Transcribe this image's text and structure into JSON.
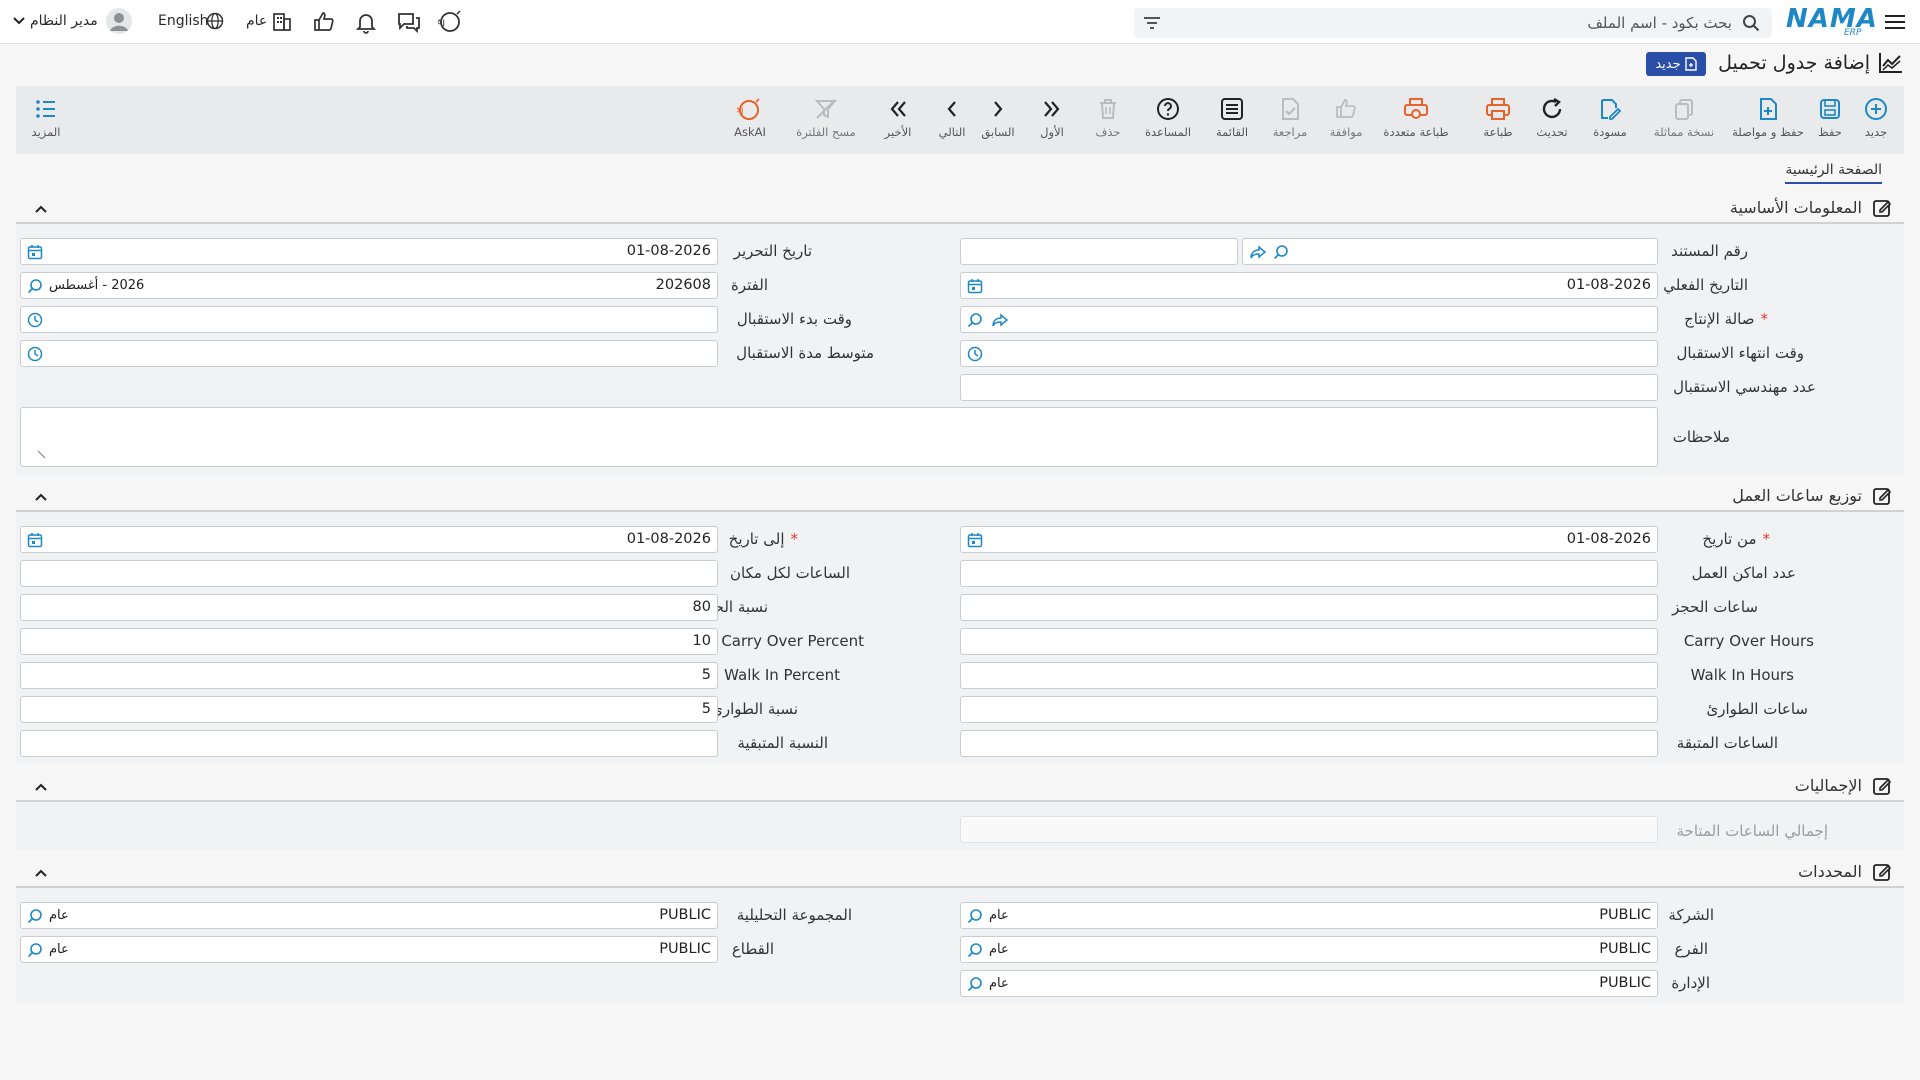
{
  "header": {
    "logo_text": "NAMA",
    "logo_sub": "ERP",
    "search_placeholder": "بحث بكود - اسم الملف",
    "user_name": "مدير النظام",
    "language": "English",
    "scope": "عام"
  },
  "page": {
    "title": "إضافة جدول تحميل",
    "badge": "جديد"
  },
  "toolbar": {
    "items": [
      {
        "label": "جديد",
        "icon": "plus-circle-icon",
        "enabled": true
      },
      {
        "label": "حفظ",
        "icon": "save-icon",
        "enabled": true
      },
      {
        "label": "حفظ و مواصلة",
        "icon": "save-continue-icon",
        "enabled": true
      },
      {
        "label": "نسخة مماثلة",
        "icon": "copy-icon",
        "enabled": false
      },
      {
        "label": "مسودة",
        "icon": "draft-icon",
        "enabled": true
      },
      {
        "label": "تحديث",
        "icon": "refresh-icon",
        "enabled": true
      },
      {
        "label": "طباعة",
        "icon": "print-icon",
        "enabled": true
      },
      {
        "label": "طباعة متعددة",
        "icon": "multi-print-icon",
        "enabled": true
      },
      {
        "label": "موافقة",
        "icon": "thumb-up-icon",
        "enabled": false
      },
      {
        "label": "مراجعة",
        "icon": "review-icon",
        "enabled": false
      },
      {
        "label": "القائمة",
        "icon": "list-icon",
        "enabled": true
      },
      {
        "label": "المساعدة",
        "icon": "help-icon",
        "enabled": true
      },
      {
        "label": "حذف",
        "icon": "trash-icon",
        "enabled": false
      },
      {
        "label": "الأول",
        "icon": "first-icon",
        "enabled": true
      },
      {
        "label": "السابق",
        "icon": "previous-icon",
        "enabled": true
      },
      {
        "label": "التالي",
        "icon": "next-icon",
        "enabled": true
      },
      {
        "label": "الأخير",
        "icon": "last-icon",
        "enabled": true
      },
      {
        "label": "مسح الفلترة",
        "icon": "clear-filter-icon",
        "enabled": false
      },
      {
        "label": "AskAI",
        "icon": "ask-ai-icon",
        "enabled": true
      }
    ],
    "more_label": "المزيد"
  },
  "tabs": {
    "main": "الصفحة الرئيسية"
  },
  "sections": {
    "basic": "المعلومات الأساسية",
    "hours": "توزيع ساعات العمل",
    "totals": "الإجماليات",
    "dims": "المحددات"
  },
  "basic": {
    "doc_no_label": "رقم المستند",
    "doc_no_value": "",
    "edit_date_label": "تاريخ التحرير",
    "edit_date_value": "01-08-2026",
    "actual_date_label": "التاريخ الفعلي",
    "actual_date_value": "01-08-2026",
    "period_label": "الفترة",
    "period_value": "202608",
    "period_tag": "2026 - أغسطس",
    "hall_label": "صالة الإنتاج",
    "hall_value": "",
    "recv_start_label": "وقت بدء الاستقبال",
    "recv_start_value": "",
    "recv_end_label": "وقت انتهاء الاستقبال",
    "recv_end_value": "",
    "avg_duration_label": "متوسط مدة الاستقبال",
    "avg_duration_value": "",
    "engineers_label": "عدد مهندسي الاستقبال",
    "engineers_value": "",
    "notes_label": "ملاحظات",
    "notes_value": ""
  },
  "hours": {
    "from_date_label": "من تاريخ",
    "from_date_value": "01-08-2026",
    "to_date_label": "إلى تاريخ",
    "to_date_value": "01-08-2026",
    "places_label": "عدد اماكن العمل",
    "places_value": "",
    "hours_per_place_label": "الساعات لكل مكان",
    "hours_per_place_value": "",
    "booking_hours_label": "ساعات الحجز",
    "booking_hours_value": "",
    "booking_pct_label": "نسبة الحجز",
    "booking_pct_value": "80",
    "carry_hours_label": "Carry Over Hours",
    "carry_hours_value": "",
    "carry_pct_label": "Carry Over Percent",
    "carry_pct_value": "10",
    "walkin_hours_label": "Walk In Hours",
    "walkin_hours_value": "",
    "walkin_pct_label": "Walk In Percent",
    "walkin_pct_value": "5",
    "emerg_hours_label": "ساعات الطوارئ",
    "emerg_hours_value": "",
    "emerg_pct_label": "نسبة الطوارئ",
    "emerg_pct_value": "5",
    "remain_hours_label": "الساعات المتبقة",
    "remain_hours_value": "",
    "remain_pct_label": "النسبة المتبقية",
    "remain_pct_value": ""
  },
  "totals": {
    "total_hours_label": "إجمالي الساعات المتاحة",
    "total_hours_value": ""
  },
  "dims": {
    "company_label": "الشركة",
    "company_value": "PUBLIC",
    "company_tag": "عام",
    "analytic_label": "المجموعة التحليلية",
    "analytic_value": "PUBLIC",
    "analytic_tag": "عام",
    "branch_label": "الفرع",
    "branch_value": "PUBLIC",
    "branch_tag": "عام",
    "sector_label": "القطاع",
    "sector_value": "PUBLIC",
    "sector_tag": "عام",
    "dept_label": "الإدارة",
    "dept_value": "PUBLIC",
    "dept_tag": "عام"
  },
  "colors": {
    "brand": "#1e88c7",
    "badge_bg": "#2b4fa8",
    "danger": "#e53935",
    "print": "#e8632b"
  }
}
